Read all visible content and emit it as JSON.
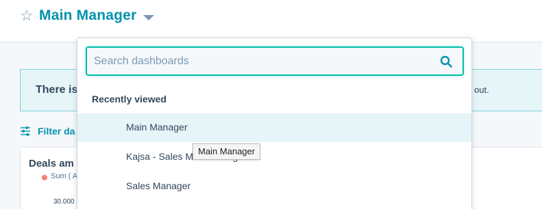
{
  "header": {
    "title": "Main Manager"
  },
  "banner": {
    "text": "There is",
    "tail": "out."
  },
  "filter": {
    "label": "Filter da"
  },
  "report_card": {
    "title": "Deals am",
    "legend": "Sum ( A",
    "axis_tick": "30.000"
  },
  "dropdown": {
    "search_placeholder": "Search dashboards",
    "search_value": "",
    "section_title": "Recently viewed",
    "items": [
      {
        "label": "Main Manager",
        "active": true
      },
      {
        "label": "Kajsa - Sales Main Manager",
        "active": false
      },
      {
        "label": "Sales Manager",
        "active": false
      }
    ]
  },
  "tooltip": {
    "text": "Main Manager"
  },
  "colors": {
    "accent": "#0091ae",
    "focus_border": "#00bda5",
    "active_row": "#e5f5f8",
    "legend_dot": "#f2826f"
  },
  "icons": [
    "star-icon",
    "chevron-down-icon",
    "filter-icon",
    "search-icon"
  ]
}
